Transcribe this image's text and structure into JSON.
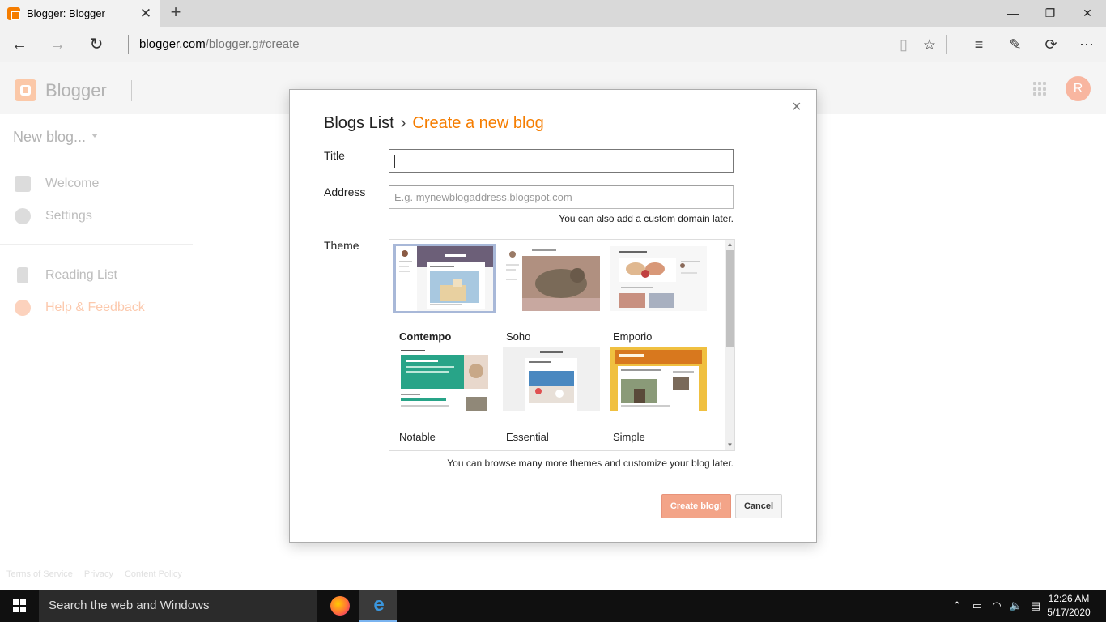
{
  "browser": {
    "tab_title": "Blogger: Blogger",
    "address_host": "blogger.com",
    "address_path": "/blogger.g#create"
  },
  "blogger": {
    "brand": "Blogger",
    "avatar_initial": "R",
    "new_blog": "New blog...",
    "nav": {
      "welcome": "Welcome",
      "settings": "Settings",
      "reading_list": "Reading List",
      "help": "Help & Feedback"
    },
    "footer": {
      "terms": "Terms of Service",
      "privacy": "Privacy",
      "content_policy": "Content Policy"
    }
  },
  "dialog": {
    "crumb_parent": "Blogs List",
    "crumb_sep": "›",
    "crumb_current": "Create a new blog",
    "title_label": "Title",
    "title_value": "",
    "address_label": "Address",
    "address_placeholder": "E.g. mynewblogaddress.blogspot.com",
    "address_hint": "You can also add a custom domain later.",
    "theme_label": "Theme",
    "themes": [
      {
        "name": "Contempo",
        "selected": true
      },
      {
        "name": "Soho",
        "selected": false
      },
      {
        "name": "Emporio",
        "selected": false
      },
      {
        "name": "Notable",
        "selected": false
      },
      {
        "name": "Essential",
        "selected": false
      },
      {
        "name": "Simple",
        "selected": false
      }
    ],
    "theme_hint": "You can browse many more themes and customize your blog later.",
    "create_button": "Create blog!",
    "cancel_button": "Cancel",
    "close_glyph": "×"
  },
  "taskbar": {
    "search_placeholder": "Search the web and Windows",
    "time": "12:26 AM",
    "date": "5/17/2020"
  },
  "colors": {
    "accent": "#f57d00",
    "create_button_bg": "#f3a488",
    "selected_theme_outline": "#a8b8d8"
  }
}
